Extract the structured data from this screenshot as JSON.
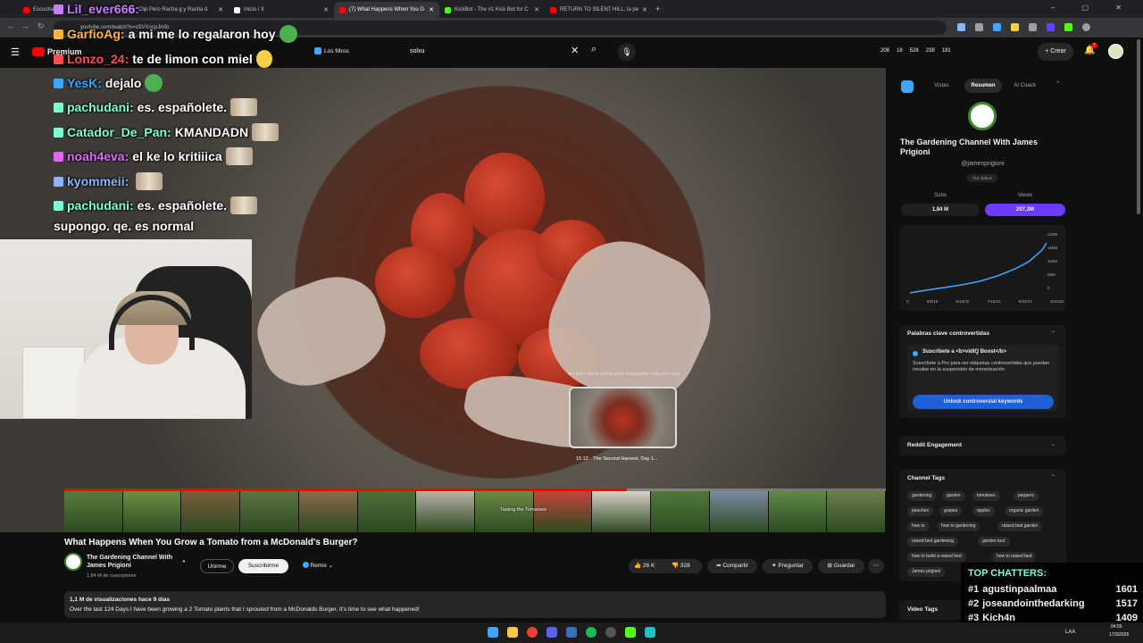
{
  "browser": {
    "tabs": [
      {
        "label": "Escucha",
        "color": "#ff0000"
      },
      {
        "label": "Clip Pero Racha g y Racha d",
        "color": "#a970ff"
      },
      {
        "label": "Inicio / X",
        "color": "#ffffff"
      },
      {
        "label": "(7) What Happens When You G",
        "color": "#ff0000"
      },
      {
        "label": "KickBot - The #1 Kick Bot for C",
        "color": "#53fc18"
      },
      {
        "label": "RETURN TO SILENT HILL: la pe",
        "color": "#ff0000"
      }
    ],
    "url": "youtube.com/watch?v=sSVXocpJmfo"
  },
  "youtube": {
    "logo_label": "Premium",
    "filters_label": "Los filtros",
    "search_value": "solxu",
    "header_stats": [
      "208",
      "18",
      "528",
      "238",
      "181"
    ],
    "create_label": "Crear",
    "notification_count": "7"
  },
  "chat": [
    {
      "user": "Lil_ever666:",
      "text": "",
      "color": "#c77dff"
    },
    {
      "user": "GarfioAg:",
      "text": "a mi me lo regalaron hoy",
      "color": "#ffb347"
    },
    {
      "user": "Lonzo_24:",
      "text": "te de limon con miel",
      "color": "#ff4d4d"
    },
    {
      "user": "YesK:",
      "text": "dejalo",
      "color": "#3ea6ff"
    },
    {
      "user": "pachudani:",
      "text": "es. españolete.",
      "color": "#7cffd4"
    },
    {
      "user": "Catador_De_Pan:",
      "text": "KMANDADN",
      "color": "#7cffd4"
    },
    {
      "user": "noah4eva:",
      "text": "el ke lo kritiiica",
      "color": "#e066ff"
    },
    {
      "user": "kyommeii:",
      "text": "",
      "color": "#8ab4ff"
    },
    {
      "user": "pachudani:",
      "text": "es. españolete.",
      "color": "#7cffd4"
    },
    {
      "user": "",
      "text": "supongo. qe. es normal",
      "color": "#ffffff"
    }
  ],
  "player": {
    "preview_hint": "Arrastra hacia arriba para búsquedas más precisas",
    "preview_time": "15:12",
    "preview_chapter": "The Second Harvest, Day 1...",
    "filmstrip_label": "Tasting the Tomatoes",
    "progress_fraction": 0.685
  },
  "video": {
    "title": "What Happens When You Grow a Tomato from a McDonald's Burger?",
    "channel": "The Gardening Channel With James Prigioni",
    "subscribers": "1,84 M de suscriptores",
    "join_label": "Unirme",
    "subscribe_label": "Suscribirme",
    "remix_label": "Remix",
    "likes": "26 K",
    "dislikes": "328",
    "share_label": "Compartir",
    "ask_label": "Preguntar",
    "save_label": "Guardar",
    "views_line": "1,1 M de visualizaciones  hace 9 días",
    "description": "Over the last 124 Days I have been growing a 2 Tomato plants that I sprouted from a McDonalds Burger, It's time to see what happened!"
  },
  "vidiq": {
    "tabs": [
      "Vistas",
      "Resumen",
      "AI Coach"
    ],
    "active_tab": "Resumen",
    "channel_name": "The Gardening Channel With James Prigioni",
    "handle": "@jamesprigioni",
    "videos": "714 vídeos",
    "subs_label": "Subs",
    "subs_value": "1,84 M",
    "views_label": "Views",
    "views_value": "207,3M",
    "chart_yticks": [
      "220M",
      "165M",
      "110M",
      "55M",
      "0"
    ],
    "chart_xticks": [
      "0",
      "9/5/18",
      "8/18/20",
      "7/15/22",
      "5/22/24",
      "3/15/26"
    ],
    "controversial_title": "Palabras clave controvertidas",
    "boost_title": "Suscríbete a <b>vidIQ Boost</b>",
    "boost_text": "Suscríbete a Pro para ver etiquetas controvertidas que puedan resultar en la suspensión de monetización",
    "unlock_label": "Unlock controversial keywords",
    "reddit_title": "Reddit Engagement",
    "tags_title": "Channel Tags",
    "tags": [
      "gardening",
      "garden",
      "tomatoes",
      "peppers",
      "peaches",
      "grapes",
      "apples",
      "organic garden",
      "how to",
      "how to gardening",
      "raised bed garden",
      "raised bed gardening",
      "garden tour",
      "how to build a raised bed",
      "how to raised bed",
      "James prigioni"
    ],
    "video_tags_title": "Video Tags",
    "accent": "#6b3bff"
  },
  "top_chatters": {
    "title": "TOP CHATTERS:",
    "rows": [
      {
        "rank": "#1",
        "name": "agustinpaalmaa",
        "count": "1601"
      },
      {
        "rank": "#2",
        "name": "joseandointhedarking",
        "count": "1517"
      },
      {
        "rank": "#3",
        "name": "Kich4n",
        "count": "1409"
      }
    ]
  },
  "taskbar": {
    "lang": "LAA",
    "time": "04:55",
    "date": "17/3/2026"
  }
}
